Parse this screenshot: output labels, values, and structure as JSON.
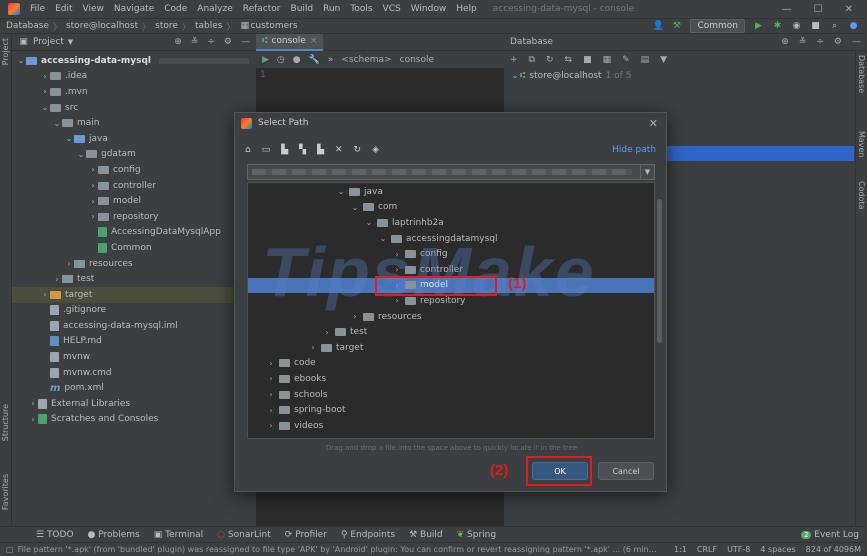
{
  "menubar": {
    "items": [
      "File",
      "Edit",
      "View",
      "Navigate",
      "Code",
      "Analyze",
      "Refactor",
      "Build",
      "Run",
      "Tools",
      "VCS",
      "Window",
      "Help"
    ],
    "title": "accessing-data-mysql - console",
    "controls": [
      "—",
      "☐",
      "✕"
    ]
  },
  "breadcrumb": {
    "items": [
      "Database",
      "store@localhost",
      "store",
      "tables",
      "customers"
    ],
    "common_label": "Common"
  },
  "project": {
    "header_label": "Project",
    "root": "accessing-data-mysql",
    "nodes": [
      {
        "label": ".idea",
        "indent": 1,
        "arrow": "›",
        "kind": "folder"
      },
      {
        "label": ".mvn",
        "indent": 1,
        "arrow": "›",
        "kind": "folder"
      },
      {
        "label": "src",
        "indent": 1,
        "arrow": "⌄",
        "kind": "folder"
      },
      {
        "label": "main",
        "indent": 2,
        "arrow": "⌄",
        "kind": "folder"
      },
      {
        "label": "java",
        "indent": 3,
        "arrow": "⌄",
        "kind": "folder-blue"
      },
      {
        "label": "gdatam",
        "indent": 4,
        "arrow": "⌄",
        "kind": "folder"
      },
      {
        "label": "config",
        "indent": 5,
        "arrow": "›",
        "kind": "folder"
      },
      {
        "label": "controller",
        "indent": 5,
        "arrow": "›",
        "kind": "folder"
      },
      {
        "label": "model",
        "indent": 5,
        "arrow": "›",
        "kind": "folder"
      },
      {
        "label": "repository",
        "indent": 5,
        "arrow": "›",
        "kind": "folder"
      },
      {
        "label": "AccessingDataMysqlApp",
        "indent": 5,
        "arrow": "",
        "kind": "file-green"
      },
      {
        "label": "Common",
        "indent": 5,
        "arrow": "",
        "kind": "file-green"
      },
      {
        "label": "resources",
        "indent": 3,
        "arrow": "›",
        "kind": "folder"
      },
      {
        "label": "test",
        "indent": 2,
        "arrow": "›",
        "kind": "folder"
      },
      {
        "label": "target",
        "indent": 1,
        "arrow": "›",
        "kind": "folder-orange",
        "selected": true
      },
      {
        "label": ".gitignore",
        "indent": 1,
        "arrow": "",
        "kind": "file"
      },
      {
        "label": "accessing-data-mysql.iml",
        "indent": 1,
        "arrow": "",
        "kind": "file"
      },
      {
        "label": "HELP.md",
        "indent": 1,
        "arrow": "",
        "kind": "file-md"
      },
      {
        "label": "mvnw",
        "indent": 1,
        "arrow": "",
        "kind": "file"
      },
      {
        "label": "mvnw.cmd",
        "indent": 1,
        "arrow": "",
        "kind": "file"
      },
      {
        "label": "pom.xml",
        "indent": 1,
        "arrow": "",
        "kind": "file-m"
      },
      {
        "label": "External Libraries",
        "indent": 0,
        "arrow": "›",
        "kind": "lib"
      },
      {
        "label": "Scratches and Consoles",
        "indent": 0,
        "arrow": "›",
        "kind": "scratch"
      }
    ]
  },
  "left_stripe": [
    "Project",
    "Structure",
    "Favorites"
  ],
  "console": {
    "tab_label": "console",
    "schema_label": "<schema>",
    "console_label": "console",
    "line_number": "1"
  },
  "database": {
    "header_label": "Database",
    "connection": "store@localhost",
    "connection_meta": "1 of 5"
  },
  "right_stripe": [
    "Database",
    "Maven",
    "Codota"
  ],
  "dialog": {
    "title": "Select Path",
    "hide_path_label": "Hide path",
    "tree": [
      {
        "label": "java",
        "indent": 6,
        "arrow": "⌄"
      },
      {
        "label": "com",
        "indent": 7,
        "arrow": "⌄"
      },
      {
        "label": "laptrinhb2a",
        "indent": 8,
        "arrow": "⌄"
      },
      {
        "label": "accessingdatamysql",
        "indent": 9,
        "arrow": "⌄"
      },
      {
        "label": "config",
        "indent": 10,
        "arrow": "›"
      },
      {
        "label": "controller",
        "indent": 10,
        "arrow": "›"
      },
      {
        "label": "model",
        "indent": 10,
        "arrow": "›",
        "highlight": true
      },
      {
        "label": "repository",
        "indent": 10,
        "arrow": "›"
      },
      {
        "label": "resources",
        "indent": 7,
        "arrow": "›"
      },
      {
        "label": "test",
        "indent": 5,
        "arrow": "›"
      },
      {
        "label": "target",
        "indent": 4,
        "arrow": "›"
      },
      {
        "label": "code",
        "indent": 1,
        "arrow": "›"
      },
      {
        "label": "ebooks",
        "indent": 1,
        "arrow": "›"
      },
      {
        "label": "schools",
        "indent": 1,
        "arrow": "›"
      },
      {
        "label": "spring-boot",
        "indent": 1,
        "arrow": "›"
      },
      {
        "label": "videos",
        "indent": 1,
        "arrow": "›"
      }
    ],
    "drag_hint": "Drag and drop a file into the space above to quickly locate it in the tree",
    "ok_label": "OK",
    "cancel_label": "Cancel"
  },
  "annotations": {
    "one": "(1)",
    "two": "(2)",
    "color": "#e31b1b"
  },
  "watermark": "TipsMake",
  "toolwindows": [
    "TODO",
    "Problems",
    "Terminal",
    "SonarLint",
    "Profiler",
    "Endpoints",
    "Build",
    "Spring"
  ],
  "event_log": {
    "count": "2",
    "label": "Event Log"
  },
  "status": {
    "message": "File pattern '*.apk' (from 'bundled' plugin) was reassigned to file type 'APK' by 'Android' plugin: You can confirm or revert reassigning pattern '*.apk' ... (6 minutes ag",
    "position": "1:1",
    "line_sep": "CRLF",
    "encoding": "UTF-8",
    "indent": "4 spaces",
    "memory": "824 of 4096M"
  },
  "colors": {
    "background": "#2b2b2b",
    "panel": "#3c3f41",
    "selection": "#4a74b8",
    "accent_blue": "#589df6",
    "ok_button": "#365880"
  }
}
